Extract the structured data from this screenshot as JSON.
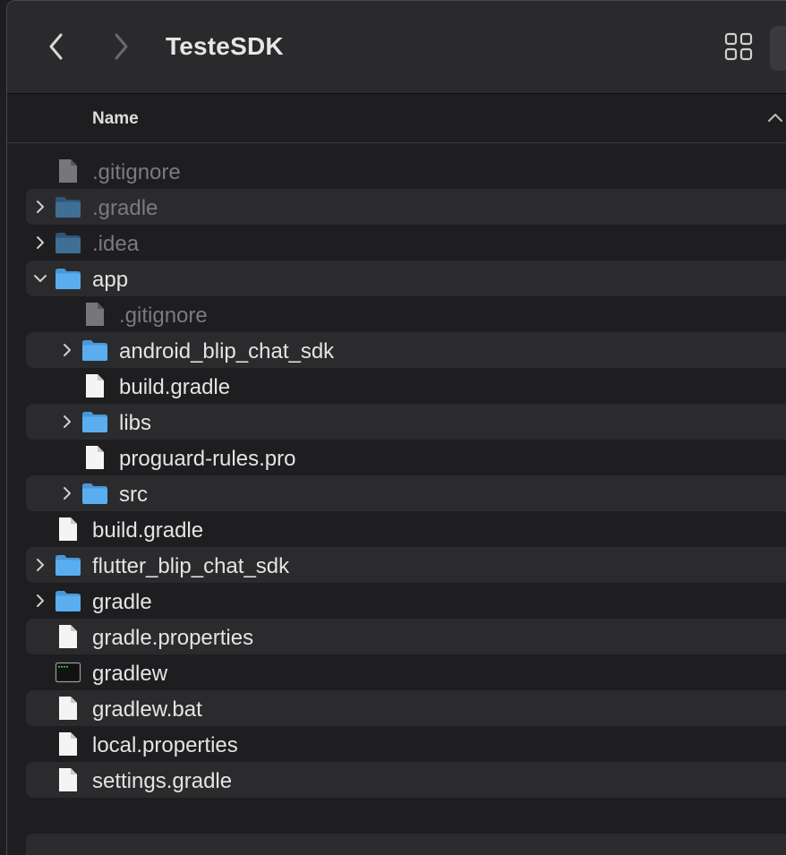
{
  "window": {
    "title": "TesteSDK",
    "back_icon": "chevron-left-icon",
    "forward_icon": "chevron-right-icon",
    "view_icon": "grid-view-icon"
  },
  "header": {
    "column_name": "Name",
    "sort_icon": "chevron-up-icon"
  },
  "colors": {
    "folder": "#5aaef0",
    "folder_dim": "#3f6f95",
    "text": "#e4e4e4",
    "text_dim": "#7b7b7e",
    "row_alt": "#2b2b2d"
  },
  "files": [
    {
      "name": ".gitignore",
      "kind": "file-gray-icon",
      "level": 0,
      "expandable": false,
      "expanded": false,
      "dim": true
    },
    {
      "name": ".gradle",
      "kind": "folder-icon",
      "level": 0,
      "expandable": true,
      "expanded": false,
      "dim": true
    },
    {
      "name": ".idea",
      "kind": "folder-icon",
      "level": 0,
      "expandable": true,
      "expanded": false,
      "dim": true
    },
    {
      "name": "app",
      "kind": "folder-icon",
      "level": 0,
      "expandable": true,
      "expanded": true,
      "dim": false
    },
    {
      "name": ".gitignore",
      "kind": "file-gray-icon",
      "level": 1,
      "expandable": false,
      "expanded": false,
      "dim": true
    },
    {
      "name": "android_blip_chat_sdk",
      "kind": "folder-icon",
      "level": 1,
      "expandable": true,
      "expanded": false,
      "dim": false
    },
    {
      "name": "build.gradle",
      "kind": "document-icon",
      "level": 1,
      "expandable": false,
      "expanded": false,
      "dim": false
    },
    {
      "name": "libs",
      "kind": "folder-icon",
      "level": 1,
      "expandable": true,
      "expanded": false,
      "dim": false
    },
    {
      "name": "proguard-rules.pro",
      "kind": "document-icon",
      "level": 1,
      "expandable": false,
      "expanded": false,
      "dim": false
    },
    {
      "name": "src",
      "kind": "folder-icon",
      "level": 1,
      "expandable": true,
      "expanded": false,
      "dim": false
    },
    {
      "name": "build.gradle",
      "kind": "document-icon",
      "level": 0,
      "expandable": false,
      "expanded": false,
      "dim": false
    },
    {
      "name": "flutter_blip_chat_sdk",
      "kind": "folder-icon",
      "level": 0,
      "expandable": true,
      "expanded": false,
      "dim": false
    },
    {
      "name": "gradle",
      "kind": "folder-icon",
      "level": 0,
      "expandable": true,
      "expanded": false,
      "dim": false
    },
    {
      "name": "gradle.properties",
      "kind": "document-icon",
      "level": 0,
      "expandable": false,
      "expanded": false,
      "dim": false
    },
    {
      "name": "gradlew",
      "kind": "terminal-exec-icon",
      "level": 0,
      "expandable": false,
      "expanded": false,
      "dim": false
    },
    {
      "name": "gradlew.bat",
      "kind": "document-icon",
      "level": 0,
      "expandable": false,
      "expanded": false,
      "dim": false
    },
    {
      "name": "local.properties",
      "kind": "document-icon",
      "level": 0,
      "expandable": false,
      "expanded": false,
      "dim": false
    },
    {
      "name": "settings.gradle",
      "kind": "document-icon",
      "level": 0,
      "expandable": false,
      "expanded": false,
      "dim": false
    }
  ]
}
